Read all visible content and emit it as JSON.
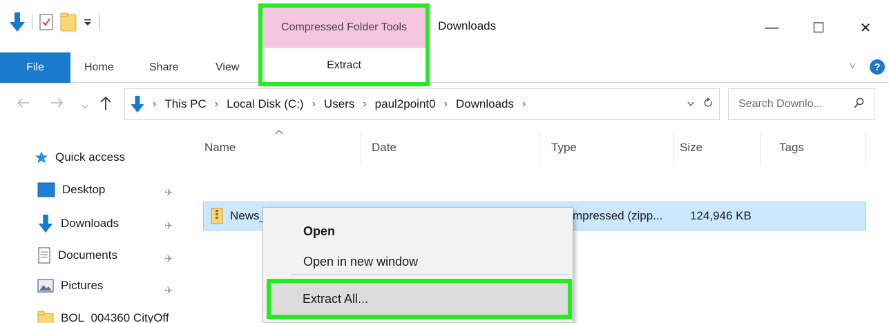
{
  "window": {
    "title": "Downloads",
    "minimize_glyph": "—",
    "maximize_glyph": "☐",
    "close_glyph": "✕"
  },
  "contextual_tab": {
    "header": "Compressed Folder Tools",
    "tab": "Extract"
  },
  "ribbon": {
    "tabs": [
      "File",
      "Home",
      "Share",
      "View"
    ],
    "expand_glyph": "˅",
    "help_glyph": "?"
  },
  "address_bar": {
    "breadcrumbs": [
      "This PC",
      "Local Disk (C:)",
      "Users",
      "paul2point0",
      "Downloads"
    ],
    "search_placeholder": "Search Downlo..."
  },
  "nav_pane": {
    "items": [
      {
        "label": "Quick access",
        "icon": "star-icon"
      },
      {
        "label": "Desktop",
        "icon": "desktop-icon",
        "pinned": true
      },
      {
        "label": "Downloads",
        "icon": "download-arrow-icon",
        "pinned": true
      },
      {
        "label": "Documents",
        "icon": "documents-icon",
        "pinned": true
      },
      {
        "label": "Pictures",
        "icon": "pictures-icon",
        "pinned": true
      },
      {
        "label": "BOL_004360 CityOff",
        "icon": "folder-icon"
      }
    ]
  },
  "file_list": {
    "columns": [
      "Name",
      "Date",
      "Type",
      "Size",
      "Tags"
    ],
    "rows": [
      {
        "name": "News_",
        "type": "mpressed (zipp...",
        "size": "124,946 KB"
      }
    ]
  },
  "context_menu": {
    "items": [
      "Open",
      "Open in new window",
      "Extract All..."
    ]
  },
  "colors": {
    "accent_blue": "#1979ca",
    "highlight_green": "#22ee1e",
    "contextual_pink": "#f6c5e0",
    "selection_blue": "#cce8ff"
  }
}
